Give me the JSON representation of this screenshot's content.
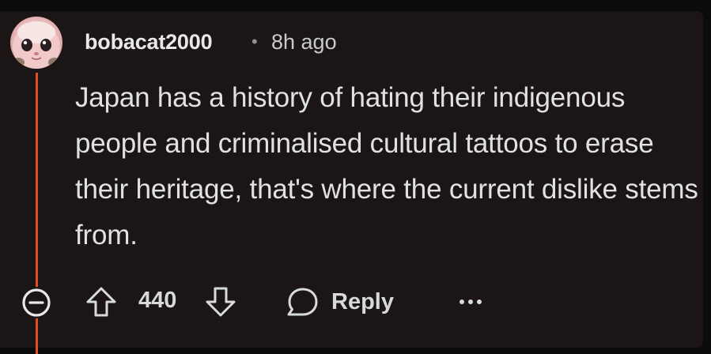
{
  "comment": {
    "username": "bobacat2000",
    "separator": "•",
    "time": "8h ago",
    "body": "Japan has a history of hating their indigenous people and criminalised cultural tattoos to erase their heritage, that's where the current dislike stems from."
  },
  "actions": {
    "score": "440",
    "reply_label": "Reply"
  },
  "colors": {
    "background": "#0b0b0b",
    "panel": "#1c1515",
    "thread_line": "#e0501f",
    "text": "#d7dadc"
  },
  "icons": {
    "collapse": "minus-circle-icon",
    "upvote": "arrow-up-icon",
    "downvote": "arrow-down-icon",
    "reply": "speech-bubble-icon",
    "more": "ellipsis-icon"
  }
}
